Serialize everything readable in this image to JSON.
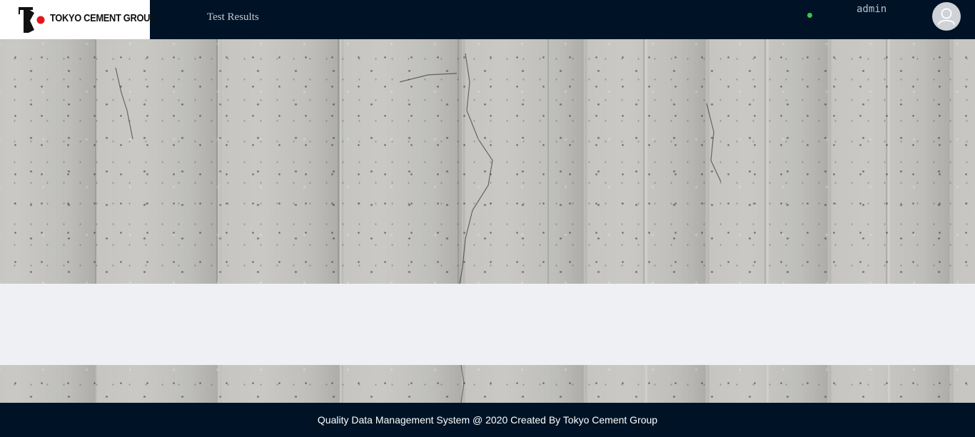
{
  "header": {
    "logo_text": "TOKYO CEMENT GROUP",
    "nav_link": "Test Results",
    "username": "admin",
    "status": "online",
    "avatar_icon": "user-icon"
  },
  "footer": {
    "text": "Quality Data Management System @ 2020 Created By Tokyo Cement Group"
  },
  "colors": {
    "header_bg": "#001326",
    "footer_bg": "#001326",
    "content_bg": "#eff0f4",
    "status_online": "#37c84a",
    "logo_red": "#e3161c"
  }
}
